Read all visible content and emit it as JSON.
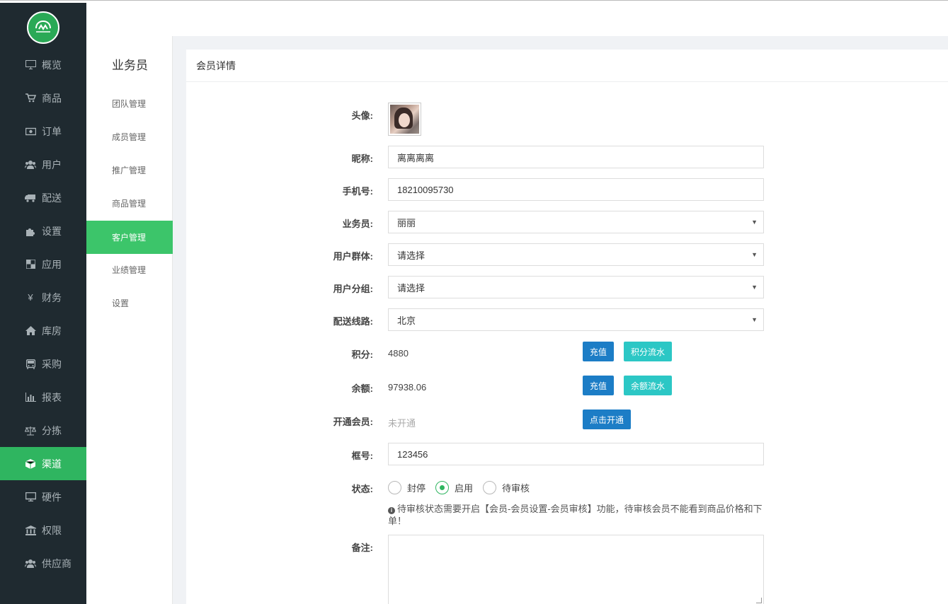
{
  "nav": {
    "items": [
      {
        "label": "概览",
        "icon": "monitor-icon"
      },
      {
        "label": "商品",
        "icon": "cart-icon"
      },
      {
        "label": "订单",
        "icon": "money-icon"
      },
      {
        "label": "用户",
        "icon": "users-icon"
      },
      {
        "label": "配送",
        "icon": "truck-icon"
      },
      {
        "label": "设置",
        "icon": "puzzle-icon"
      },
      {
        "label": "应用",
        "icon": "grid-icon"
      },
      {
        "label": "财务",
        "icon": "yen-icon"
      },
      {
        "label": "库房",
        "icon": "home-icon"
      },
      {
        "label": "采购",
        "icon": "bus-icon"
      },
      {
        "label": "报表",
        "icon": "bar-chart-icon"
      },
      {
        "label": "分拣",
        "icon": "scale-icon"
      },
      {
        "label": "渠道",
        "icon": "cube-icon"
      },
      {
        "label": "硬件",
        "icon": "desktop-icon"
      },
      {
        "label": "权限",
        "icon": "bank-icon"
      },
      {
        "label": "供应商",
        "icon": "users-icon"
      }
    ],
    "active_index": 12
  },
  "subnav": {
    "title": "业务员",
    "items": [
      "团队管理",
      "成员管理",
      "推广管理",
      "商品管理",
      "客户管理",
      "业绩管理",
      "设置"
    ],
    "active_index": 4
  },
  "panel": {
    "title": "会员详情"
  },
  "form": {
    "avatar_label": "头像:",
    "nickname_label": "昵称:",
    "nickname": "离离离离",
    "phone_label": "手机号:",
    "phone": "18210095730",
    "salesman_label": "业务员:",
    "salesman": "丽丽",
    "group_label": "用户群体:",
    "group": "请选择",
    "category_label": "用户分组:",
    "category": "请选择",
    "route_label": "配送线路:",
    "route": "北京",
    "points_label": "积分:",
    "points": "4880",
    "points_recharge": "充值",
    "points_flow": "积分流水",
    "balance_label": "余额:",
    "balance": "97938.06",
    "balance_recharge": "充值",
    "balance_flow": "余额流水",
    "member_label": "开通会员:",
    "member_status": "未开通",
    "member_open": "点击开通",
    "box_label": "框号:",
    "box": "123456",
    "status_label": "状态:",
    "status_options": [
      "封停",
      "启用",
      "待审核"
    ],
    "status_selected": 1,
    "hint": "待审核状态需要开启【会员-会员设置-会员审核】功能，待审核会员不能看到商品价格和下单！",
    "remark_label": "备注:"
  },
  "colors": {
    "nav_bg": "#1f2a30",
    "accent": "#2fb560",
    "blue_button": "#1c7dc6",
    "teal_button": "#2cc7c5"
  }
}
